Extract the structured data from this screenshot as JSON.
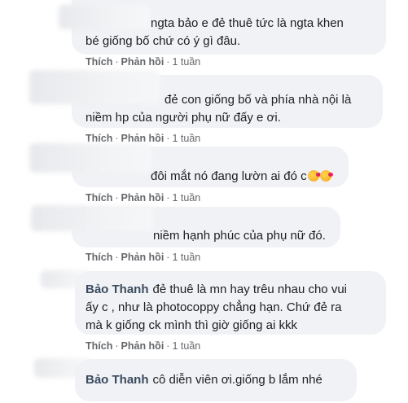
{
  "comments": [
    {
      "author": "",
      "line1": "ngta bảo e đẻ thuê tức là ngta khen",
      "line2": "bé giống bố chứ có ý gì đâu."
    },
    {
      "author": "",
      "line1": "đẻ con giống bố và phía nhà nội là",
      "line2": "niềm hp của người phụ nữ đấy e ơi."
    },
    {
      "author": "",
      "line1": "đôi mắt nó đang lườn ai đó c",
      "emoji": [
        "smiling-hearts-icon",
        "smiling-hearts-icon"
      ]
    },
    {
      "author": "",
      "line1": "niềm hạnh phúc của phụ nữ đó."
    },
    {
      "author": "Bảo Thanh",
      "line1": "đẻ thuê là mn hay trêu nhau cho vui",
      "line2": "ấy c , như là photocoppy chẳng hạn. Chứ đẻ ra",
      "line3": "mà k giống ck mình thì giờ giống ai kkk"
    },
    {
      "author": "Bảo Thanh",
      "line1": "cô diễn viên ơi.giống b lắm nhé"
    }
  ],
  "actions": {
    "like": "Thích",
    "reply": "Phản hồi",
    "separator": "·",
    "time": "1 tuần"
  }
}
